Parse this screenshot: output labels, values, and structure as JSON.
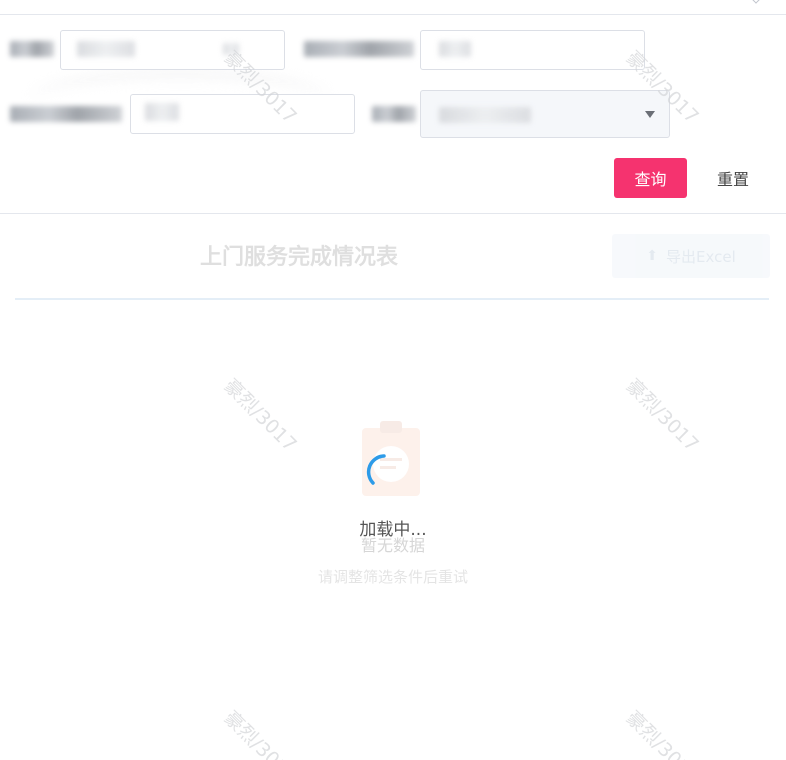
{
  "filters": {
    "row1": [
      {
        "label": "(blurred)",
        "value": "(blurred)"
      },
      {
        "label": "(blurred)",
        "value": "(blurred)"
      }
    ],
    "row2": [
      {
        "label": "(blurred)",
        "value": "(blurred)"
      },
      {
        "label": "(blurred)",
        "value": "(blurred)"
      }
    ]
  },
  "actions": {
    "query_label": "查询",
    "reset_label": "重置"
  },
  "table": {
    "title": "上门服务完成情况表",
    "export_label": "导出Excel"
  },
  "empty_state": {
    "title": "暂无数据",
    "subtitle": "请调整筛选条件后重试"
  },
  "loading": {
    "text": "加载中..."
  },
  "watermark": {
    "text": "豪烈/3017"
  },
  "colors": {
    "primary": "#f5336f",
    "spinner": "#2d9be8",
    "export_button": "#bcd0e6"
  },
  "icons": {
    "select_arrow": "caret-down-icon",
    "export": "upload-icon",
    "empty": "clipboard-icon",
    "loading": "spinner-icon"
  }
}
